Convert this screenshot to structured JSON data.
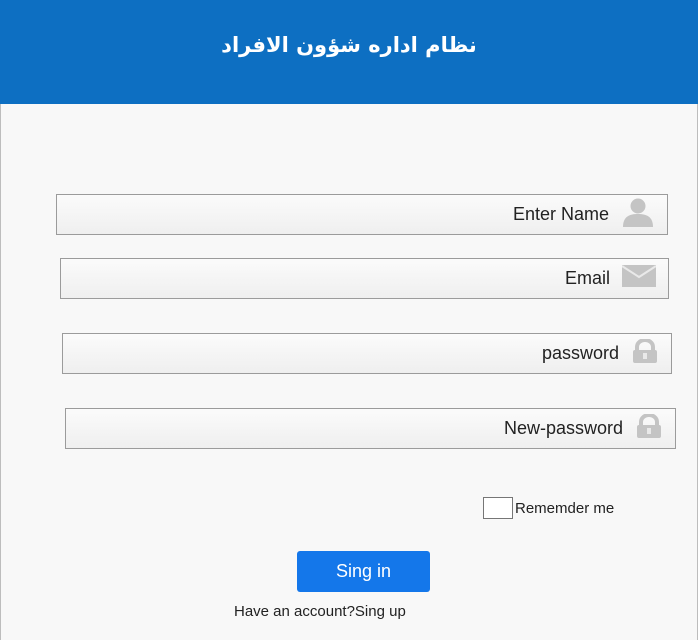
{
  "header": {
    "title": "نظام اداره شؤون الافراد"
  },
  "form": {
    "name_placeholder": "Enter Name",
    "email_placeholder": "Email",
    "password_placeholder": "password",
    "new_password_placeholder": "New-password",
    "remember_label": "Rememder me",
    "remember_checked": false,
    "signin_label": "Sing in",
    "signup_text": "Have an account?Sing up"
  },
  "icons": {
    "name": "user-icon",
    "email": "envelope-icon",
    "password": "lock-icon",
    "new_password": "lock-icon"
  },
  "colors": {
    "header_bg": "#0d6fc2",
    "button_bg": "#1477ea",
    "icon_gray": "#c4c4c4"
  }
}
